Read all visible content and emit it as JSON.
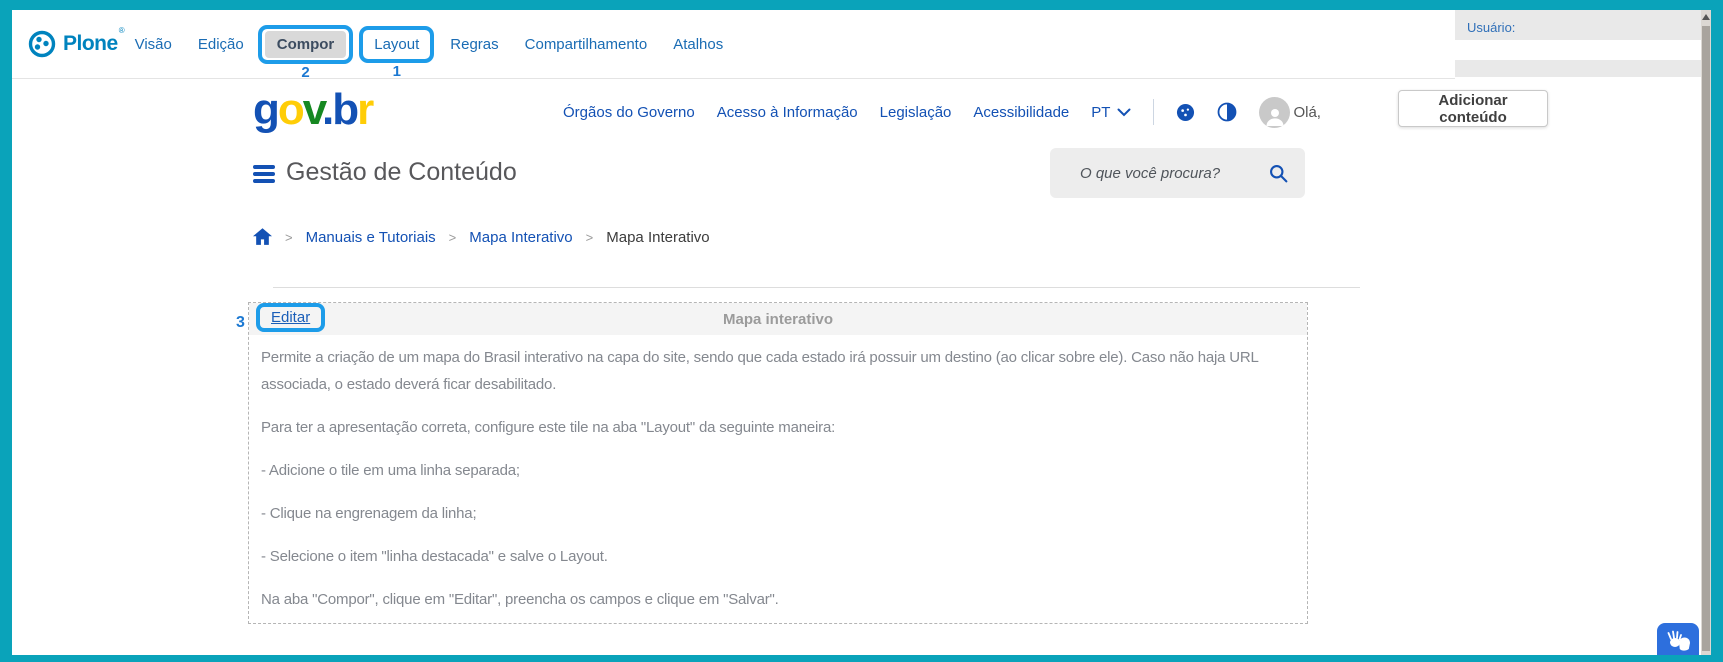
{
  "colors": {
    "frame_teal": "#0aa3ba",
    "annotation_blue": "#1d9ce9",
    "annotation_number_blue": "#1b78d2",
    "plone_blue": "#0083be",
    "govbr_blue": "#1351B4",
    "govbr_yellow": "#FFCD07",
    "govbr_green": "#168821",
    "vlibras_blue": "#2d6fdd"
  },
  "plone_toolbar": {
    "logo_text": "Plone",
    "items": [
      {
        "label": "Visão"
      },
      {
        "label": "Edição"
      },
      {
        "label": "Compor",
        "active": true,
        "annotation": "2"
      },
      {
        "label": "Layout",
        "annotation": "1"
      },
      {
        "label": "Regras"
      },
      {
        "label": "Compartilhamento"
      },
      {
        "label": "Atalhos"
      }
    ]
  },
  "personal_panel": {
    "user_label": "Usuário:"
  },
  "actions": {
    "add_content": "Adicionar conteúdo"
  },
  "govbr": {
    "logo_letters": [
      {
        "ch": "g",
        "color": "#1351B4"
      },
      {
        "ch": "o",
        "color": "#FFCD07"
      },
      {
        "ch": "v",
        "color": "#168821"
      },
      {
        "ch": ".",
        "color": "#1351B4"
      },
      {
        "ch": "b",
        "color": "#1351B4"
      },
      {
        "ch": "r",
        "color": "#FFCD07"
      }
    ],
    "nav_links": [
      "Órgãos do Governo",
      "Acesso à Informação",
      "Legislação",
      "Acessibilidade"
    ],
    "language": "PT",
    "greeting": "Olá,"
  },
  "content_bar": {
    "title": "Gestão de Conteúdo",
    "search_placeholder": "O que você procura?"
  },
  "breadcrumb": {
    "separator": ">",
    "items": [
      {
        "label": "Manuais e Tutoriais"
      },
      {
        "label": "Mapa Interativo"
      },
      {
        "label": "Mapa Interativo",
        "current": true
      }
    ]
  },
  "tile": {
    "edit_label": "Editar",
    "edit_annotation": "3",
    "title": "Mapa interativo",
    "paragraphs": [
      "Permite a criação de um mapa do Brasil interativo na capa do site, sendo que cada estado irá possuir um destino (ao clicar sobre ele). Caso não haja URL associada, o estado deverá ficar desabilitado.",
      "Para ter a apresentação correta, configure este tile na aba \"Layout\" da seguinte maneira:",
      "- Adicione o tile em uma linha separada;",
      "- Clique na engrenagem da linha;",
      "- Selecione o item \"linha destacada\" e salve o Layout.",
      "Na aba \"Compor\", clique em \"Editar\", preencha os campos e clique em \"Salvar\"."
    ]
  }
}
